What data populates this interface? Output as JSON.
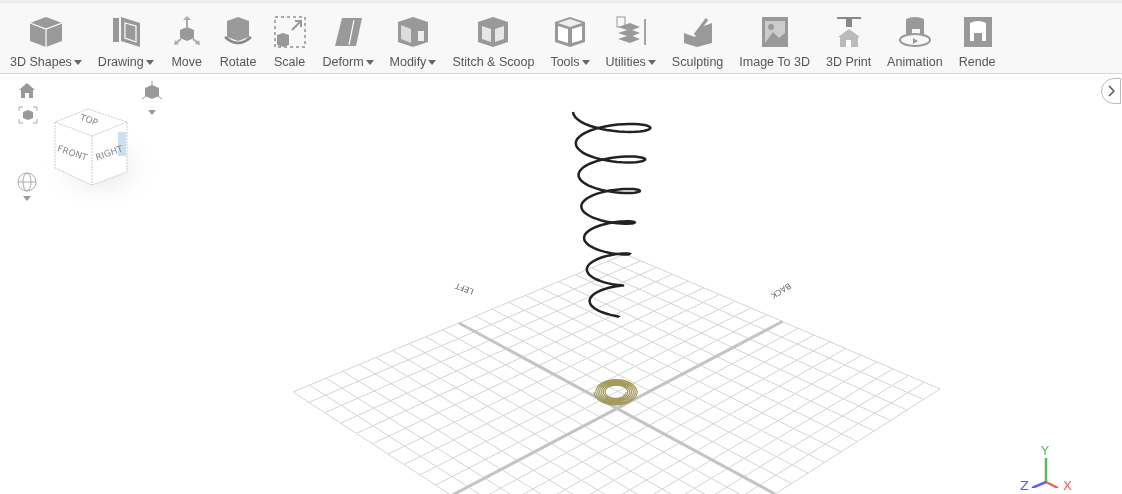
{
  "toolbar": {
    "items": [
      {
        "label": "3D Shapes",
        "dropdown": true
      },
      {
        "label": "Drawing",
        "dropdown": true
      },
      {
        "label": "Move",
        "dropdown": false
      },
      {
        "label": "Rotate",
        "dropdown": false
      },
      {
        "label": "Scale",
        "dropdown": false
      },
      {
        "label": "Deform",
        "dropdown": true
      },
      {
        "label": "Modify",
        "dropdown": true
      },
      {
        "label": "Stitch & Scoop",
        "dropdown": false
      },
      {
        "label": "Tools",
        "dropdown": true
      },
      {
        "label": "Utilities",
        "dropdown": true
      },
      {
        "label": "Sculpting",
        "dropdown": false
      },
      {
        "label": "Image To 3D",
        "dropdown": false
      },
      {
        "label": "3D Print",
        "dropdown": false
      },
      {
        "label": "Animation",
        "dropdown": false
      },
      {
        "label": "Rende",
        "dropdown": false
      }
    ]
  },
  "view_cube": {
    "faces": [
      "TOP",
      "FRONT",
      "RIGHT"
    ]
  },
  "grid_labels": [
    "LEFT",
    "BACK"
  ],
  "axes": [
    "Y",
    "Z",
    "X"
  ]
}
